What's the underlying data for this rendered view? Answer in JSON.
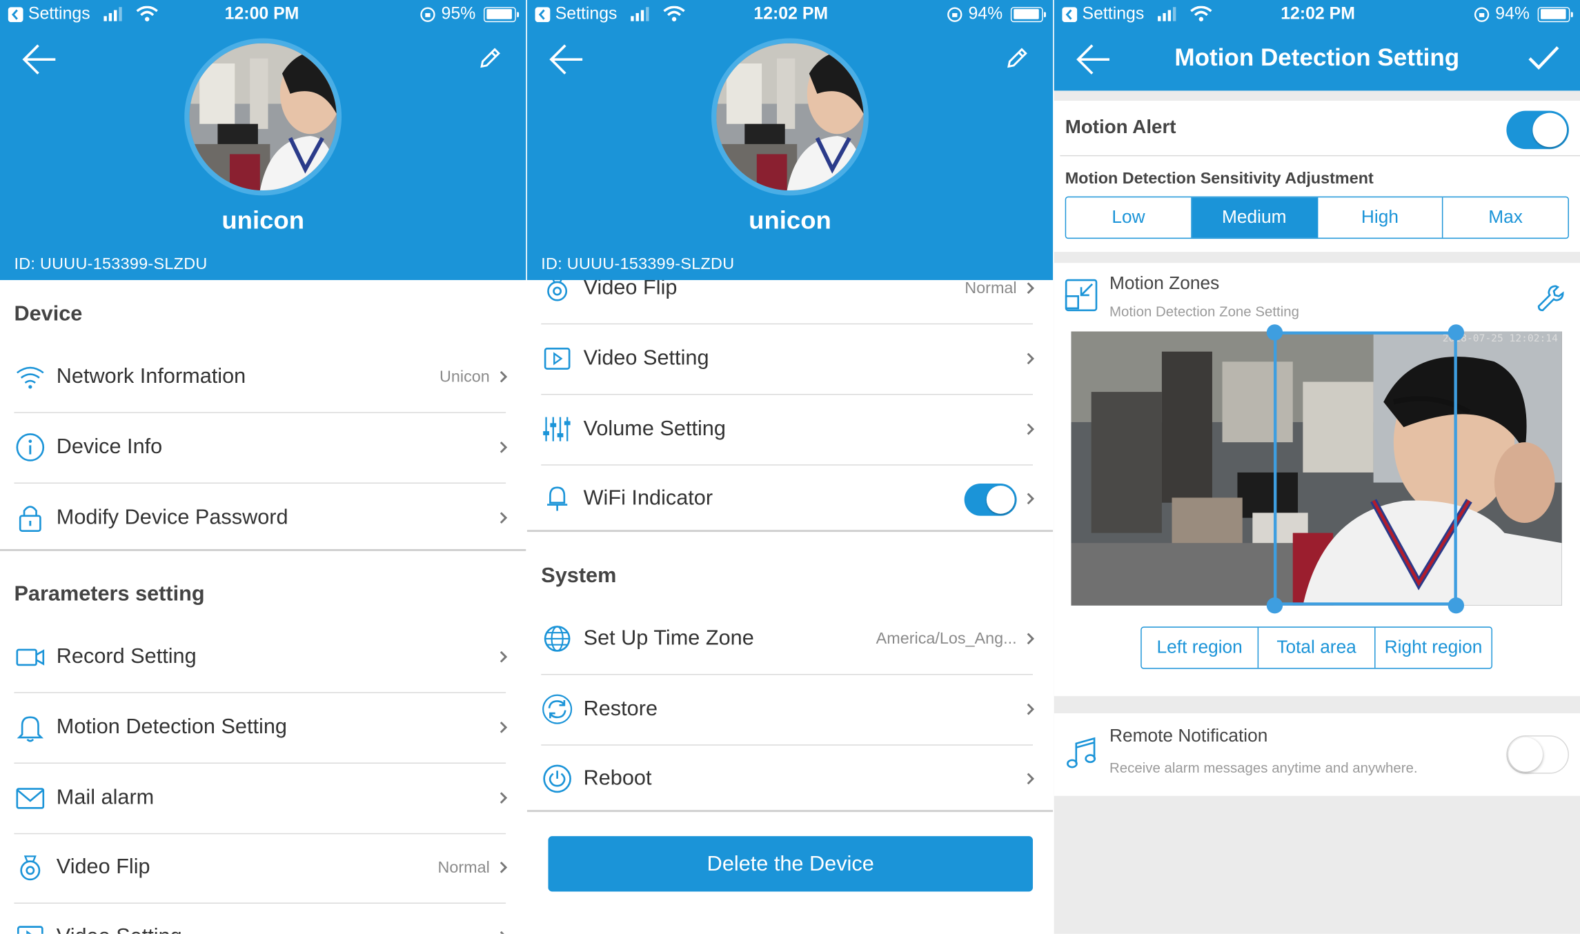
{
  "colors": {
    "accent": "#1b94d8",
    "bg_grey": "#ebebeb"
  },
  "panel1": {
    "status": {
      "back_app": "Settings",
      "time": "12:00 PM",
      "battery": "95%",
      "battery_level": 0.95
    },
    "header": {
      "device_name": "unicon",
      "device_id": "ID: UUUU-153399-SLZDU"
    },
    "device_section": "Device",
    "device_items": [
      {
        "label": "Network Information",
        "value": "Unicon",
        "icon": "wifi-icon"
      },
      {
        "label": "Device Info",
        "value": "",
        "icon": "info-icon"
      },
      {
        "label": "Modify Device Password",
        "value": "",
        "icon": "lock-icon"
      }
    ],
    "params_section": "Parameters setting",
    "param_items": [
      {
        "label": "Record Setting",
        "value": "",
        "icon": "video-camera-icon"
      },
      {
        "label": "Motion Detection Setting",
        "value": "",
        "icon": "bell-icon"
      },
      {
        "label": "Mail alarm",
        "value": "",
        "icon": "mail-icon"
      },
      {
        "label": "Video Flip",
        "value": "Normal",
        "icon": "flip-camera-icon"
      },
      {
        "label": "Video Setting",
        "value": "",
        "icon": "video-setting-icon"
      }
    ]
  },
  "panel2": {
    "status": {
      "back_app": "Settings",
      "time": "12:02 PM",
      "battery": "94%",
      "battery_level": 0.94
    },
    "header": {
      "device_name": "unicon",
      "device_id": "ID: UUUU-153399-SLZDU"
    },
    "param_items": [
      {
        "label": "Video Flip",
        "value": "Normal",
        "icon": "flip-camera-icon"
      },
      {
        "label": "Video Setting",
        "value": "",
        "icon": "video-setting-icon"
      },
      {
        "label": "Volume Setting",
        "value": "",
        "icon": "volume-sliders-icon"
      },
      {
        "label": "WiFi Indicator",
        "value": "",
        "icon": "bulb-icon",
        "toggle_on": true
      }
    ],
    "system_section": "System",
    "system_items": [
      {
        "label": "Set Up Time Zone",
        "value": "America/Los_Ang...",
        "icon": "globe-icon"
      },
      {
        "label": "Restore",
        "value": "",
        "icon": "restore-icon"
      },
      {
        "label": "Reboot",
        "value": "",
        "icon": "power-icon"
      }
    ],
    "delete_label": "Delete the Device"
  },
  "panel3": {
    "status": {
      "back_app": "Settings",
      "time": "12:02 PM",
      "battery": "94%",
      "battery_level": 0.94
    },
    "title": "Motion Detection Setting",
    "motion_alert_label": "Motion Alert",
    "motion_alert_on": true,
    "sensitivity_label": "Motion Detection Sensitivity Adjustment",
    "sensitivity_options": [
      "Low",
      "Medium",
      "High",
      "Max"
    ],
    "sensitivity_selected": "Medium",
    "zones_title": "Motion Zones",
    "zones_subtitle": "Motion Detection Zone Setting",
    "preview_timestamp": "2018-07-25 12:02:14",
    "region_options": [
      "Left region",
      "Total area",
      "Right region"
    ],
    "remote_title": "Remote Notification",
    "remote_subtitle": "Receive alarm messages anytime and anywhere.",
    "remote_on": false
  }
}
